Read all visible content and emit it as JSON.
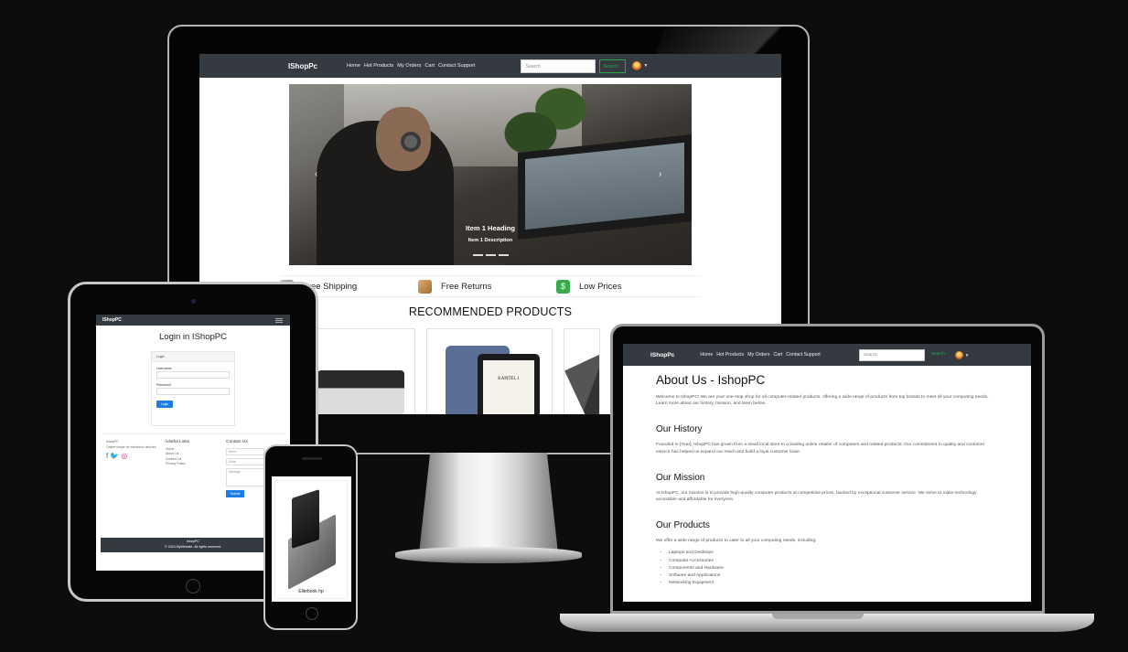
{
  "site": {
    "brand_desktop": "IShopPc",
    "brand_tablet": "IShopPC",
    "brand_laptop": "IShopPc",
    "nav_links": [
      "Home",
      "Hot Products",
      "My Orders",
      "Cart",
      "Contact Support"
    ],
    "search_placeholder": "Search",
    "search_button": "Search"
  },
  "monitor": {
    "carousel": {
      "heading": "Item 1 Heading",
      "description": "Item 1 Description",
      "prev_icon": "‹",
      "next_icon": "›"
    },
    "features": [
      {
        "label": "Free Shipping",
        "icon": "truck-icon"
      },
      {
        "label": "Free Returns",
        "icon": "box-icon"
      },
      {
        "label": "Low Prices",
        "icon": "dollar-icon"
      }
    ],
    "recommended_title": "RECOMMENDED PRODUCTS",
    "kindle_text": "KAPITEL 1"
  },
  "tablet": {
    "login_title": "Login in IShopPC",
    "card_header": "Login",
    "username_label": "Username",
    "password_label": "Password",
    "login_button": "Login",
    "footer": {
      "brand": "IshopPC",
      "tagline": "Online shope for electronic devices",
      "useful_links_title": "Useful Links",
      "useful_links": [
        "Home",
        "About Us",
        "Contact Us",
        "Privacy Policy"
      ],
      "contact_title": "Contact Us",
      "name_placeholder": "Name",
      "email_placeholder": "Email",
      "message_placeholder": "Message",
      "submit_button": "Submit"
    },
    "copyright_brand": "IshopPC",
    "copyright": "© 2024 MyWebsite. All rights reserved."
  },
  "phone": {
    "product_title": "Elitebook hp"
  },
  "laptop": {
    "title": "About Us - IshopPC",
    "intro": "Welcome to IshopPC! We are your one-stop shop for all computer-related products, offering a wide range of products from top brands to meet all your computing needs. Learn more about our history, mission, and team below.",
    "history_title": "Our History",
    "history": "Founded in [Year], IshopPC has grown from a small local store to a leading online retailer of computers and related products. Our commitment to quality and customer service has helped us expand our reach and build a loyal customer base.",
    "mission_title": "Our Mission",
    "mission": "At IshopPC, our mission is to provide high-quality computer products at competitive prices, backed by exceptional customer service. We strive to make technology accessible and affordable for everyone.",
    "products_title": "Our Products",
    "products_intro": "We offer a wide range of products to cater to all your computing needs, including:",
    "products": [
      "Laptops and Desktops",
      "Computer Accessories",
      "Components and Hardware",
      "Software and Applications",
      "Networking Equipment"
    ]
  },
  "colors": {
    "navbar": "#343a40",
    "search_green": "#28a745",
    "primary_blue": "#1b7ee6",
    "background": "#0d0d0d"
  }
}
